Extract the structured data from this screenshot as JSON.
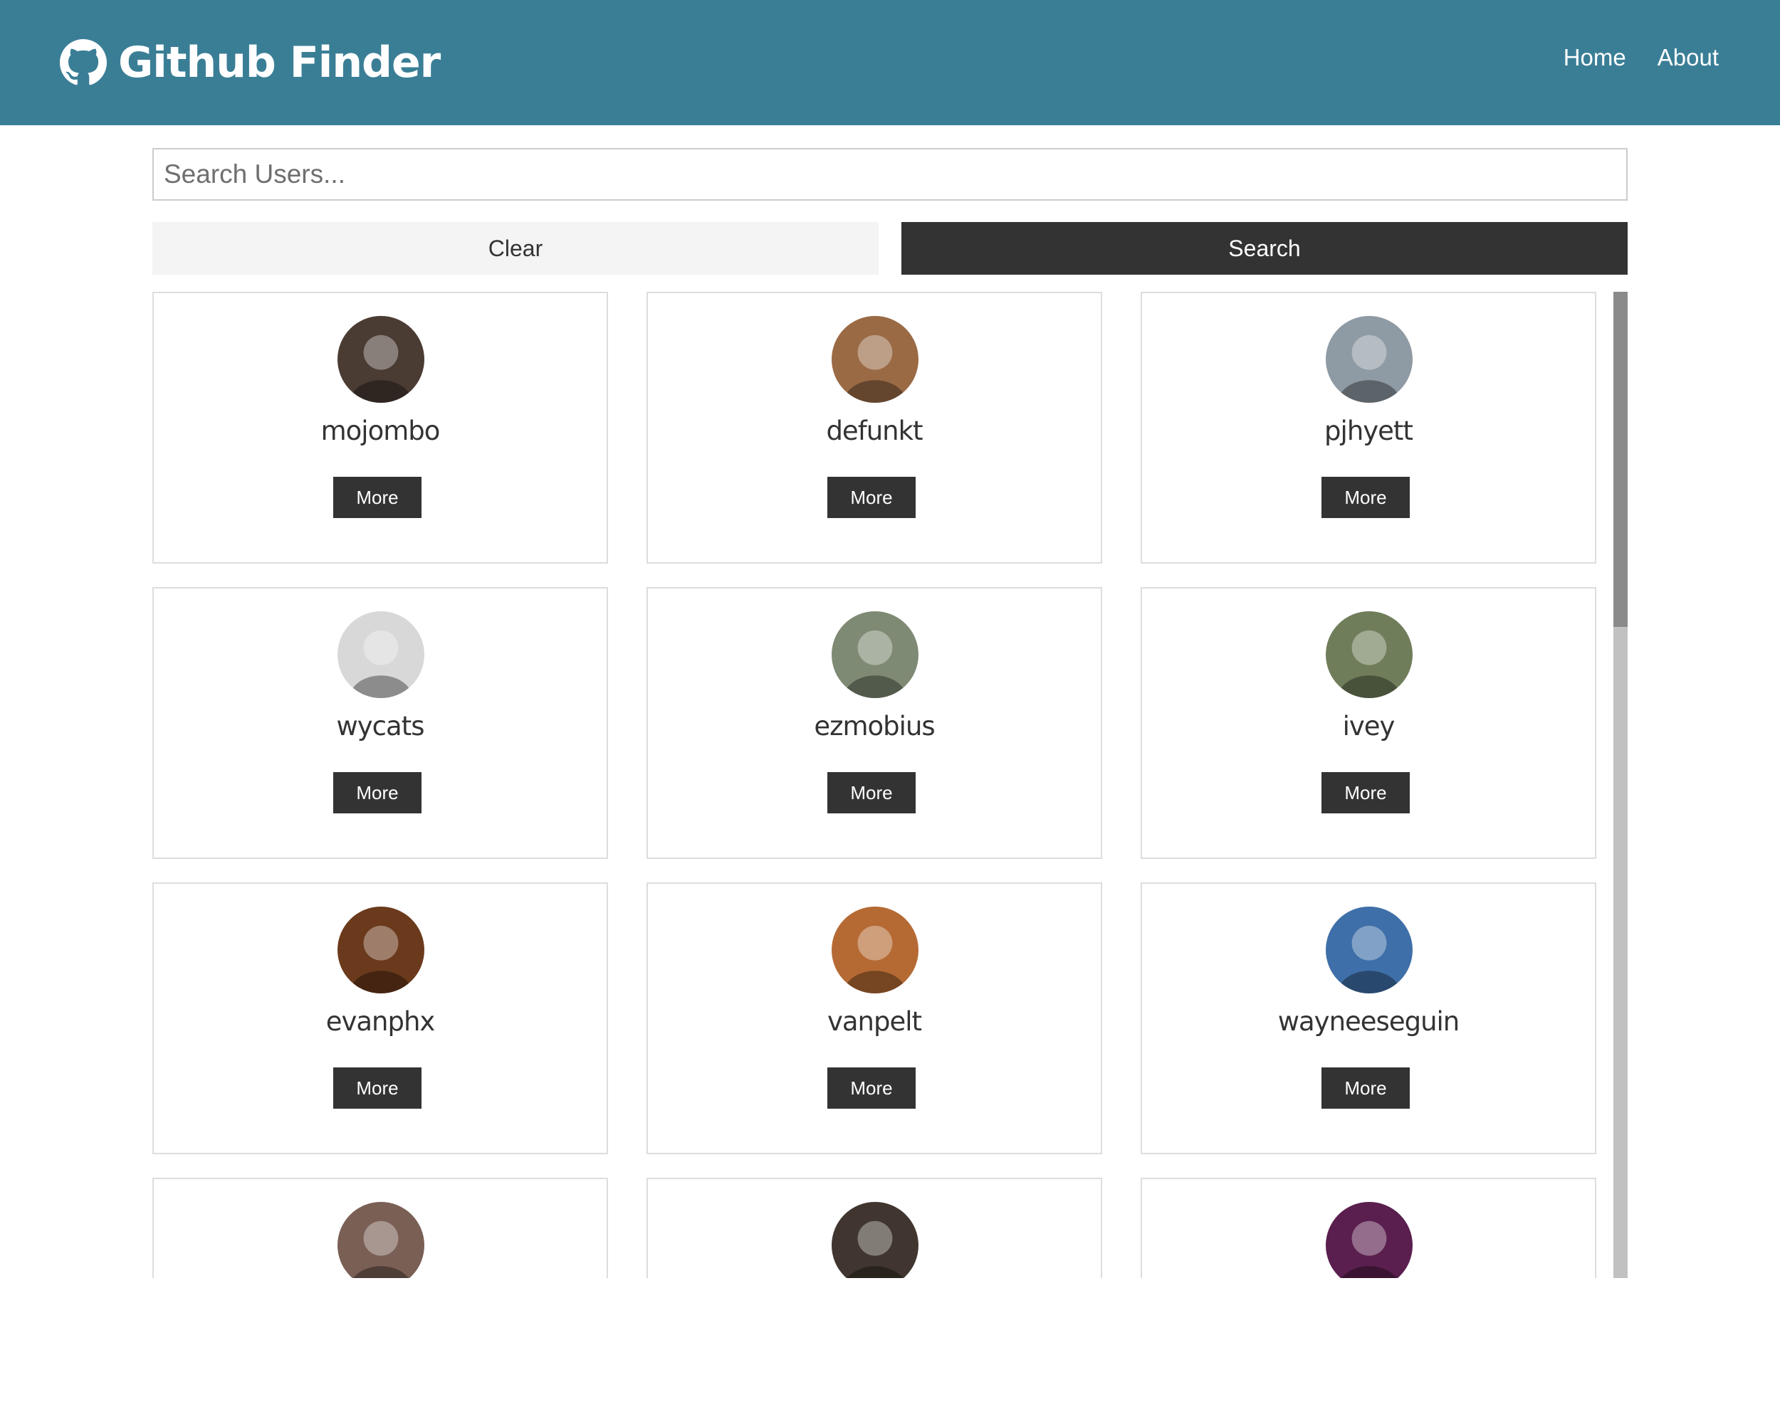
{
  "navbar": {
    "brand_icon": "github-icon",
    "title": "Github Finder",
    "links": [
      {
        "label": "Home"
      },
      {
        "label": "About"
      }
    ],
    "background": "#3a7e96"
  },
  "search": {
    "placeholder": "Search Users...",
    "value": "",
    "clear_label": "Clear",
    "search_label": "Search"
  },
  "users": [
    {
      "login": "mojombo",
      "more_label": "More",
      "avatar_color": "#4a3b33"
    },
    {
      "login": "defunkt",
      "more_label": "More",
      "avatar_color": "#9a6a45"
    },
    {
      "login": "pjhyett",
      "more_label": "More",
      "avatar_color": "#8e9aa4"
    },
    {
      "login": "wycats",
      "more_label": "More",
      "avatar_color": "#d8d8d8"
    },
    {
      "login": "ezmobius",
      "more_label": "More",
      "avatar_color": "#7e8a73"
    },
    {
      "login": "ivey",
      "more_label": "More",
      "avatar_color": "#6f7d5a"
    },
    {
      "login": "evanphx",
      "more_label": "More",
      "avatar_color": "#6b3a1c"
    },
    {
      "login": "vanpelt",
      "more_label": "More",
      "avatar_color": "#b56a34"
    },
    {
      "login": "wayneeseguin",
      "more_label": "More",
      "avatar_color": "#3f6fa8"
    },
    {
      "login": "",
      "more_label": "",
      "avatar_color": "#7a5f55"
    },
    {
      "login": "",
      "more_label": "",
      "avatar_color": "#40362f"
    },
    {
      "login": "",
      "more_label": "",
      "avatar_color": "#5a1f4e"
    }
  ],
  "scrollbar": {
    "position_fraction": 0.0,
    "visible_fraction": 0.34
  }
}
